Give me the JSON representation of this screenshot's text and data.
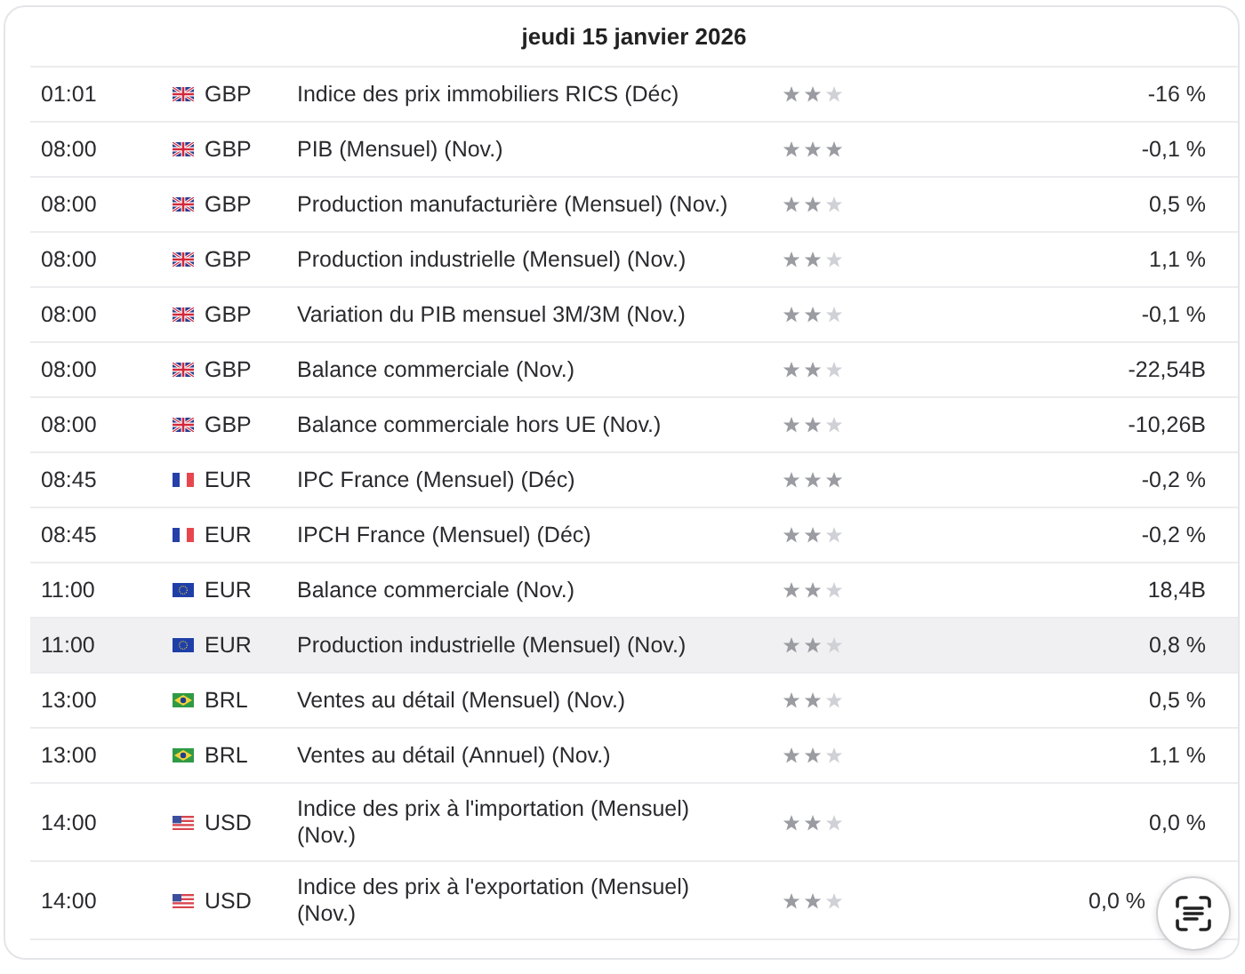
{
  "header": {
    "date": "jeudi 15 janvier 2026"
  },
  "rows": [
    {
      "time": "01:01",
      "kind": "gb",
      "currency": "GBP",
      "event": "Indice des prix immobiliers RICS  (Déc)",
      "stars": 2,
      "value": "-16 %",
      "highlighted": false
    },
    {
      "time": "08:00",
      "kind": "gb",
      "currency": "GBP",
      "event": "PIB (Mensuel) (Nov.)",
      "stars": 3,
      "value": "-0,1 %",
      "highlighted": false
    },
    {
      "time": "08:00",
      "kind": "gb",
      "currency": "GBP",
      "event": "Production manufacturière (Mensuel) (Nov.)",
      "stars": 2,
      "value": "0,5 %",
      "highlighted": false
    },
    {
      "time": "08:00",
      "kind": "gb",
      "currency": "GBP",
      "event": "Production industrielle (Mensuel) (Nov.)",
      "stars": 2,
      "value": "1,1 %",
      "highlighted": false
    },
    {
      "time": "08:00",
      "kind": "gb",
      "currency": "GBP",
      "event": "Variation du PIB mensuel 3M/3M  (Nov.)",
      "stars": 2,
      "value": "-0,1 %",
      "highlighted": false
    },
    {
      "time": "08:00",
      "kind": "gb",
      "currency": "GBP",
      "event": "Balance commerciale  (Nov.)",
      "stars": 2,
      "value": "-22,54B",
      "highlighted": false
    },
    {
      "time": "08:00",
      "kind": "gb",
      "currency": "GBP",
      "event": "Balance commerciale hors UE  (Nov.)",
      "stars": 2,
      "value": "-10,26B",
      "highlighted": false
    },
    {
      "time": "08:45",
      "kind": "fr",
      "currency": "EUR",
      "event": "IPC France (Mensuel) (Déc)",
      "stars": 3,
      "value": "-0,2 %",
      "highlighted": false
    },
    {
      "time": "08:45",
      "kind": "fr",
      "currency": "EUR",
      "event": "IPCH France (Mensuel) (Déc)",
      "stars": 2,
      "value": "-0,2 %",
      "highlighted": false
    },
    {
      "time": "11:00",
      "kind": "eu",
      "currency": "EUR",
      "event": "Balance commerciale  (Nov.)",
      "stars": 2,
      "value": "18,4B",
      "highlighted": false
    },
    {
      "time": "11:00",
      "kind": "eu",
      "currency": "EUR",
      "event": "Production industrielle (Mensuel) (Nov.)",
      "stars": 2,
      "value": "0,8 %",
      "highlighted": true
    },
    {
      "time": "13:00",
      "kind": "br",
      "currency": "BRL",
      "event": "Ventes au détail (Mensuel) (Nov.)",
      "stars": 2,
      "value": "0,5 %",
      "highlighted": false
    },
    {
      "time": "13:00",
      "kind": "br",
      "currency": "BRL",
      "event": "Ventes au détail (Annuel) (Nov.)",
      "stars": 2,
      "value": "1,1 %",
      "highlighted": false
    },
    {
      "time": "14:00",
      "kind": "us",
      "currency": "USD",
      "event": "Indice des prix à l'importation (Mensuel) (Nov.)",
      "stars": 2,
      "value": "0,0 %",
      "highlighted": false
    },
    {
      "time": "14:00",
      "kind": "us",
      "currency": "USD",
      "event": "Indice des prix à l'exportation (Mensuel) (Nov.)",
      "stars": 2,
      "value": "0,0 %",
      "highlighted": false
    }
  ]
}
